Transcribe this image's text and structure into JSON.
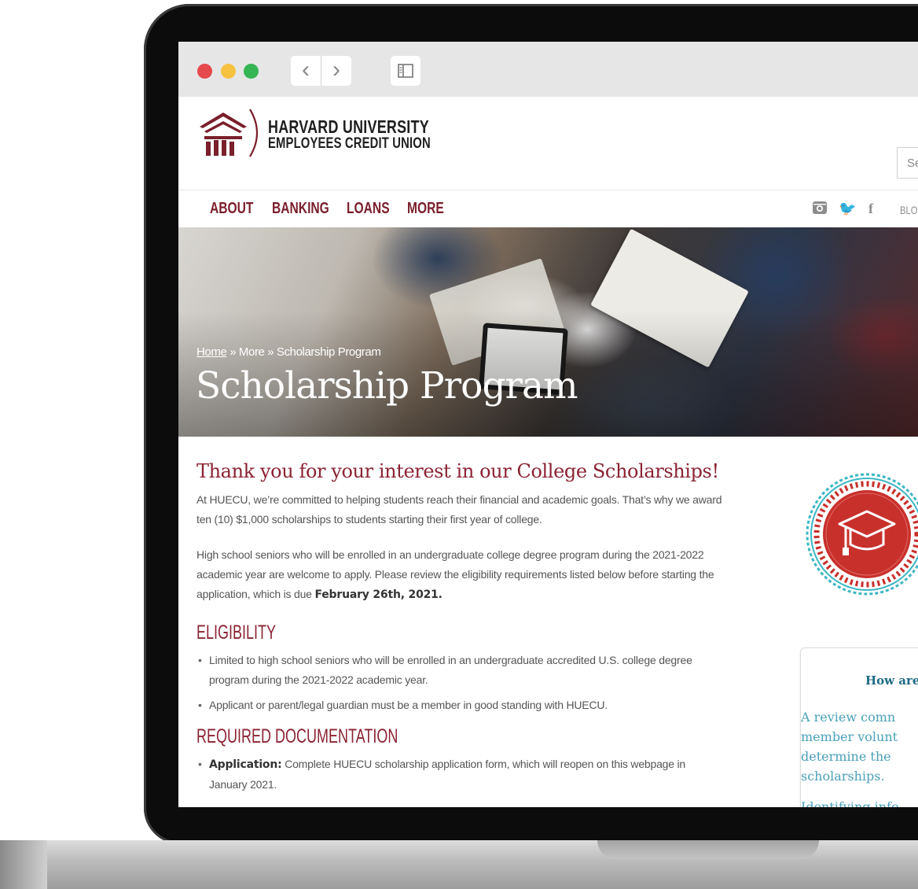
{
  "browser": {
    "back_symbol": "‹",
    "forward_symbol": "›"
  },
  "site": {
    "brand_line1": "HARVARD UNIVERSITY",
    "brand_line2": "EMPLOYEES CREDIT UNION",
    "search_placeholder": "Se",
    "colors": {
      "brand": "#7a1f2b",
      "accent_teal": "#1d6b86"
    }
  },
  "nav": {
    "items": [
      "ABOUT",
      "BANKING",
      "LOANS",
      "MORE"
    ],
    "social_icons": [
      "instagram-icon",
      "twitter-icon",
      "facebook-icon"
    ],
    "twitter_glyph": "🐦",
    "facebook_glyph": "f",
    "blog_label": "BLO"
  },
  "hero": {
    "breadcrumb": {
      "home": "Home",
      "sep1": " » ",
      "more": "More",
      "sep2": " » ",
      "current": "Scholarship Program"
    },
    "title": "Scholarship Program"
  },
  "content": {
    "intro_heading": "Thank you for your interest in our College Scholarships!",
    "intro_para": "At HUECU, we’re committed to helping students reach their financial and academic goals. That’s why we award ten (10) $1,000 scholarships to students starting their first year of college.",
    "second_para_text": "High school seniors who will be enrolled in an undergraduate college degree program during the 2021-2022 academic year are welcome to apply. Please review the eligibility requirements listed below before starting the application, which is due ",
    "second_para_bold": "February 26th, 2021.",
    "eligibility_heading": "ELIGIBILITY",
    "eligibility_items": [
      "Limited to high school seniors who will be enrolled in an undergraduate accredited U.S. college degree program during the 2021-2022 academic year.",
      "Applicant or parent/legal guardian must be a member in good standing with HUECU."
    ],
    "docs_heading": "REQUIRED DOCUMENTATION",
    "docs_items": [
      {
        "label": "Application:",
        "text": " Complete HUECU scholarship application form, which will reopen on this webpage in January 2021."
      }
    ]
  },
  "sidebar": {
    "badge_icon": "graduation-cap-icon",
    "card_title": "How are",
    "card_lines": [
      "A review comn",
      "member volunt",
      "determine the",
      "scholarships.",
      "Identifying info"
    ]
  }
}
